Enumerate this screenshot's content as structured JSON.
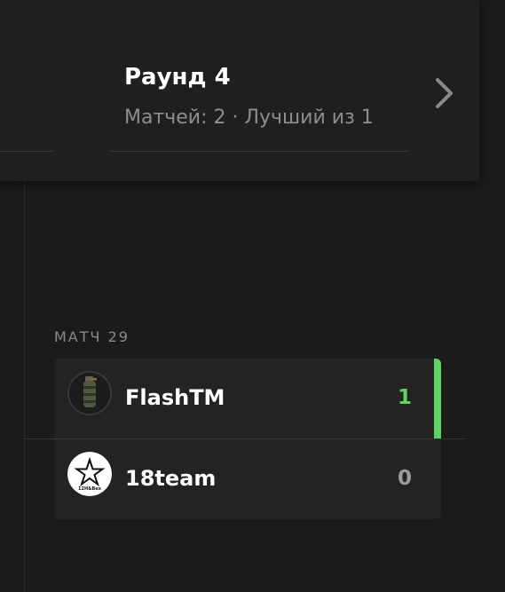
{
  "round": {
    "title": "Раунд 4",
    "subtitle": "Матчей: 2 · Лучший из 1"
  },
  "match": {
    "label": "МАТЧ 29",
    "teams": [
      {
        "name": "FlashTM",
        "score": "1",
        "winner": true,
        "avatar_icon": "grenade-logo-icon"
      },
      {
        "name": "18team",
        "score": "0",
        "winner": false,
        "avatar_icon": "star-badge-logo-icon",
        "avatar_text": "12H&Bex"
      }
    ]
  },
  "colors": {
    "background": "#1b1b1b",
    "card": "#232323",
    "winner_accent": "#5dd464",
    "muted_text": "#8e8e8e"
  }
}
